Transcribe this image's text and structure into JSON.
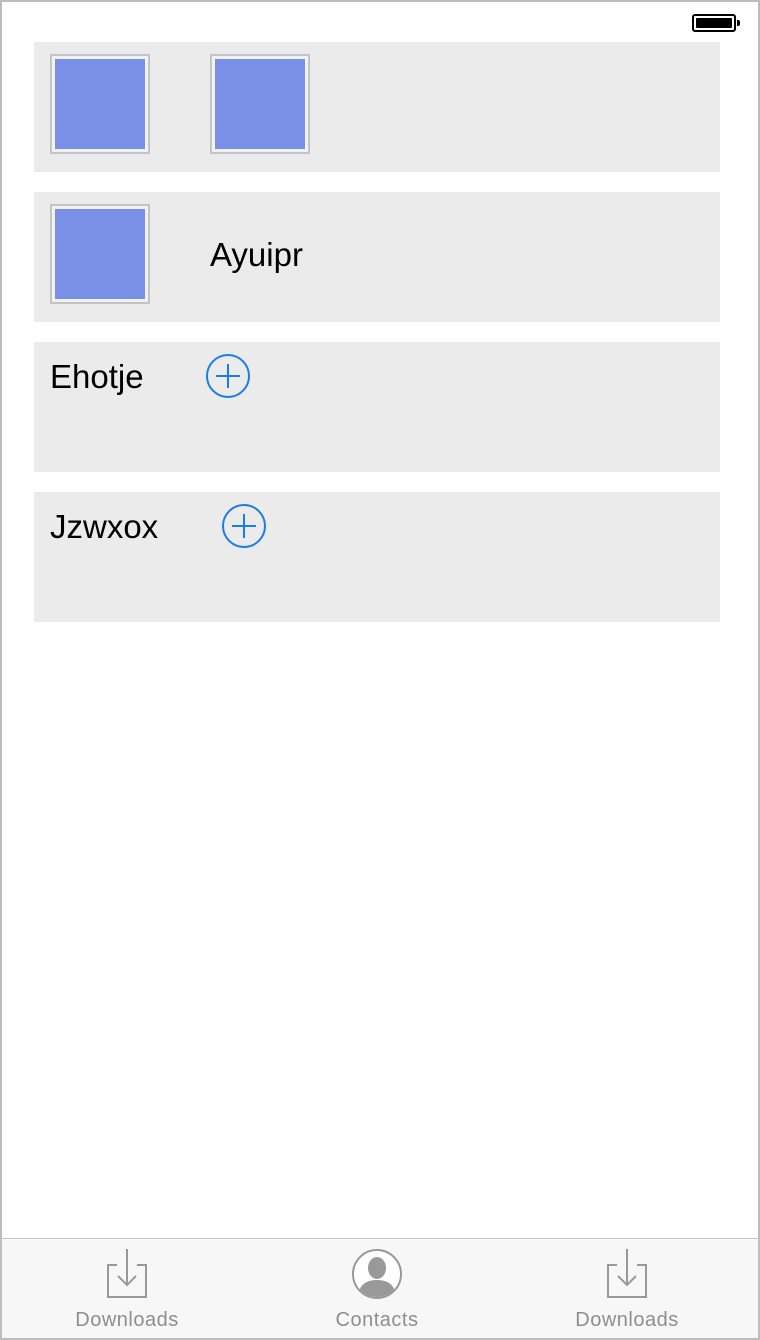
{
  "status_bar": {
    "battery_icon": "battery-full-icon"
  },
  "cells": [
    {
      "type": "images",
      "thumbnails": [
        "image-placeholder",
        "image-placeholder"
      ]
    },
    {
      "type": "image-label",
      "label": "Ayuipr"
    },
    {
      "type": "label-add",
      "label": "Ehotje",
      "button_icon": "plus-circle-icon"
    },
    {
      "type": "label-add",
      "label": "Jzwxox",
      "button_icon": "plus-circle-icon"
    }
  ],
  "tab_bar": {
    "tabs": [
      {
        "label": "Downloads",
        "icon": "download-icon"
      },
      {
        "label": "Contacts",
        "icon": "contact-icon"
      },
      {
        "label": "Downloads",
        "icon": "download-icon"
      }
    ]
  },
  "colors": {
    "cell_background": "#ebebeb",
    "thumbnail_fill": "#7a8fe6",
    "accent_blue": "#1a7ee6",
    "tab_label_gray": "#8e8e8e"
  }
}
